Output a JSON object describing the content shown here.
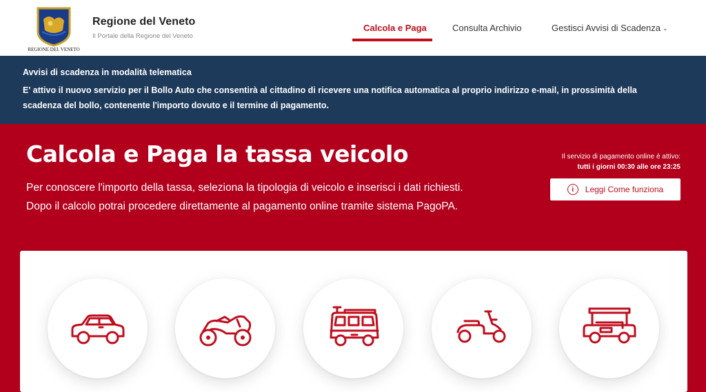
{
  "header": {
    "logo_text": "REGIONE DEL VENETO",
    "title": "Regione del Veneto",
    "subtitle": "Il Portale della Regione del Veneto",
    "nav": [
      {
        "label": "Calcola e Paga",
        "active": true
      },
      {
        "label": "Consulta Archivio",
        "active": false
      },
      {
        "label": "Gestisci Avvisi di Scadenza",
        "active": false,
        "has_dropdown": true
      }
    ]
  },
  "notice": {
    "title": "Avvisi di scadenza in modalità telematica",
    "text": "E' attivo il nuovo servizio per il Bollo Auto che consentirà al cittadino di ricevere una notifica automatica al proprio indirizzo e-mail, in prossimità della scadenza del bollo, contenente l'importo dovuto e il termine di pagamento."
  },
  "hero": {
    "title": "Calcola e Paga la tassa veicolo",
    "desc_line1": "Per conoscere l'importo della tassa, seleziona la tipologia di veicolo e inserisci i dati richiesti.",
    "desc_line2": "Dopo il calcolo potrai procedere direttamente al pagamento online tramite sistema PagoPA.",
    "service_label": "Il servizio di pagamento online è attivo:",
    "service_hours": "tutti i giorni 00:30 alle ore 23:25",
    "how_button": "Leggi Come funziona",
    "info_glyph": "i"
  },
  "vehicles": [
    {
      "icon": "car-icon"
    },
    {
      "icon": "motorcycle-icon"
    },
    {
      "icon": "camper-van-icon"
    },
    {
      "icon": "scooter-icon"
    },
    {
      "icon": "golf-cart-icon"
    }
  ],
  "colors": {
    "accent_red": "#c00d1e",
    "hero_red": "#b2001c",
    "notice_navy": "#1e3a5a"
  }
}
